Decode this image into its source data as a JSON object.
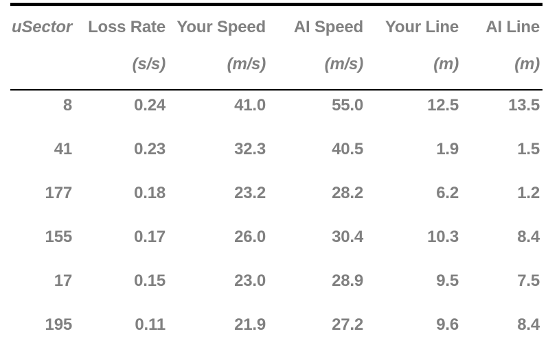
{
  "table": {
    "columns": [
      {
        "name": "uSector",
        "unit": "",
        "italic": true,
        "key": "usector"
      },
      {
        "name": "Loss Rate",
        "unit": "(s/s)",
        "italic": false,
        "key": "loss_rate"
      },
      {
        "name": "Your Speed",
        "unit": "(m/s)",
        "italic": false,
        "key": "your_speed"
      },
      {
        "name": "AI Speed",
        "unit": "(m/s)",
        "italic": false,
        "key": "ai_speed"
      },
      {
        "name": "Your Line",
        "unit": "(m)",
        "italic": false,
        "key": "your_line"
      },
      {
        "name": "AI Line",
        "unit": "(m)",
        "italic": false,
        "key": "ai_line"
      }
    ],
    "header_names": [
      "uSector",
      "Loss Rate",
      "Your Speed",
      "AI Speed",
      "Your Line",
      "AI Line"
    ],
    "header_units": [
      "",
      "(s/s)",
      "(m/s)",
      "(m/s)",
      "(m)",
      "(m)"
    ],
    "rows": [
      {
        "usector": "8",
        "loss_rate": "0.24",
        "your_speed": "41.0",
        "ai_speed": "55.0",
        "your_line": "12.5",
        "ai_line": "13.5"
      },
      {
        "usector": "41",
        "loss_rate": "0.23",
        "your_speed": "32.3",
        "ai_speed": "40.5",
        "your_line": "1.9",
        "ai_line": "1.5"
      },
      {
        "usector": "177",
        "loss_rate": "0.18",
        "your_speed": "23.2",
        "ai_speed": "28.2",
        "your_line": "6.2",
        "ai_line": "1.2"
      },
      {
        "usector": "155",
        "loss_rate": "0.17",
        "your_speed": "26.0",
        "ai_speed": "30.4",
        "your_line": "10.3",
        "ai_line": "8.4"
      },
      {
        "usector": "17",
        "loss_rate": "0.15",
        "your_speed": "23.0",
        "ai_speed": "28.9",
        "your_line": "9.5",
        "ai_line": "7.5"
      },
      {
        "usector": "195",
        "loss_rate": "0.11",
        "your_speed": "21.9",
        "ai_speed": "27.2",
        "your_line": "9.6",
        "ai_line": "8.4"
      }
    ],
    "colors": {
      "text": "#808080",
      "rule": "#000000",
      "background": "#ffffff"
    }
  },
  "chart_data": {
    "type": "table",
    "title": "",
    "columns": [
      "uSector",
      "Loss Rate (s/s)",
      "Your Speed (m/s)",
      "AI Speed (m/s)",
      "Your Line (m)",
      "AI Line (m)"
    ],
    "rows": [
      [
        8,
        0.24,
        41.0,
        55.0,
        12.5,
        13.5
      ],
      [
        41,
        0.23,
        32.3,
        40.5,
        1.9,
        1.5
      ],
      [
        177,
        0.18,
        23.2,
        28.2,
        6.2,
        1.2
      ],
      [
        155,
        0.17,
        26.0,
        30.4,
        10.3,
        8.4
      ],
      [
        17,
        0.15,
        23.0,
        28.9,
        9.5,
        7.5
      ],
      [
        195,
        0.11,
        21.9,
        27.2,
        9.6,
        8.4
      ]
    ]
  }
}
